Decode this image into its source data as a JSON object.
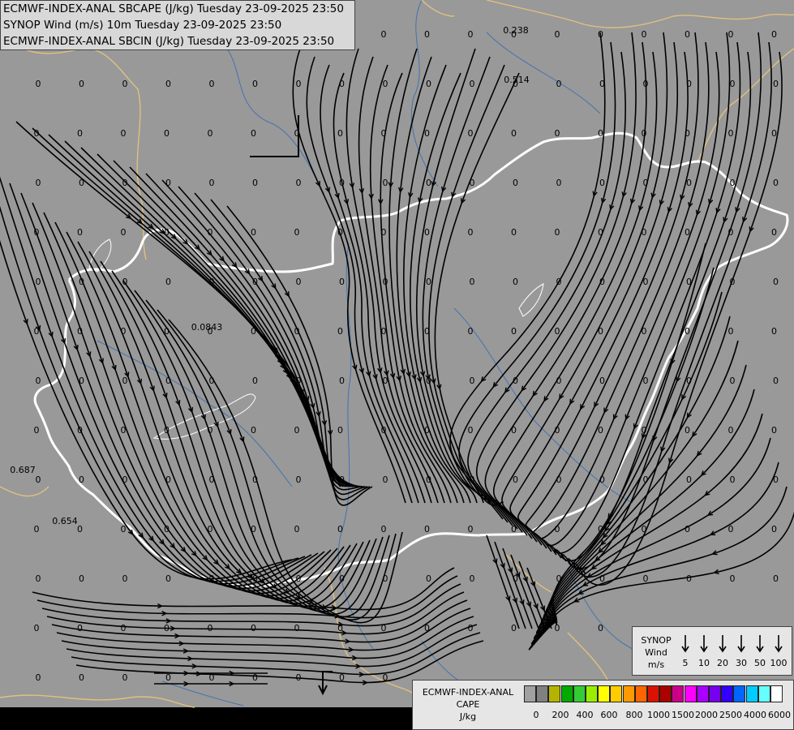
{
  "header": {
    "line1": "ECMWF-INDEX-ANAL SBCAPE (J/kg) Tuesday 23-09-2025 23:50",
    "line2": "SYNOP Wind (m/s) 10m Tuesday 23-09-2025 23:50",
    "line3": "ECMWF-INDEX-ANAL SBCIN (J/kg) Tuesday 23-09-2025 23:50"
  },
  "map_colors": {
    "background": "#999999",
    "streamline": "#000000",
    "border_highlight": "#ffffff",
    "national_border": "#e0c080",
    "river": "#3a6fb0",
    "value_text": "#000000"
  },
  "value_labels": {
    "special": [
      "0.238",
      "0.514",
      "0.0843",
      "0.687",
      "0.654"
    ]
  },
  "synop_legend": {
    "title_lines": [
      "SYNOP",
      "Wind",
      "m/s"
    ],
    "values": [
      "5",
      "10",
      "20",
      "30",
      "50",
      "100"
    ],
    "icon": "wind-arrow-icon"
  },
  "cape_legend": {
    "title_lines": [
      "ECMWF-INDEX-ANAL",
      "CAPE",
      "J/kg"
    ],
    "colors": [
      "#a0a0a0",
      "#808080",
      "#b4b400",
      "#00aa00",
      "#33cc33",
      "#99ee00",
      "#ffff00",
      "#ffcc00",
      "#ff9900",
      "#ff6600",
      "#dd1100",
      "#aa0000",
      "#cc0088",
      "#ff00ff",
      "#aa00ff",
      "#7700ee",
      "#3300ff",
      "#0066ff",
      "#00ccff",
      "#66ffff",
      "#ffffff"
    ],
    "ticks": [
      "0",
      "200",
      "400",
      "600",
      "800",
      "1000",
      "1500",
      "2000",
      "2500",
      "4000",
      "6000"
    ]
  }
}
